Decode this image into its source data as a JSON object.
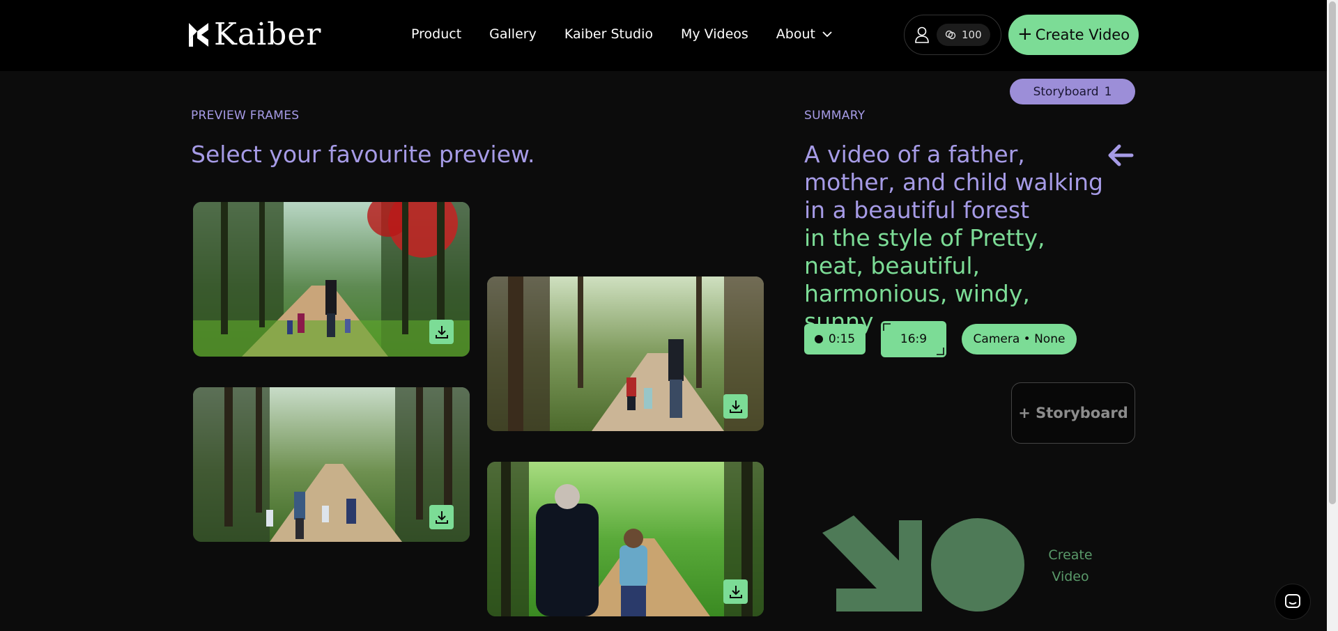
{
  "header": {
    "logo_text": "Kaiber",
    "nav": [
      {
        "label": "Product"
      },
      {
        "label": "Gallery"
      },
      {
        "label": "Kaiber Studio"
      },
      {
        "label": "My Videos"
      },
      {
        "label": "About"
      }
    ],
    "credits": "100",
    "create_label": "Create Video"
  },
  "storyboard_badge": {
    "label": "Storyboard",
    "count": "1"
  },
  "preview": {
    "section_label": "PREVIEW FRAMES",
    "headline": "Select your favourite preview."
  },
  "summary": {
    "section_label": "SUMMARY",
    "prompt": "A video of a father, mother, and child walking in a beautiful forest",
    "style": "in the style of Pretty, neat, beautiful, harmonious, windy, sunny",
    "duration": "0:15",
    "aspect_ratio": "16:9",
    "camera": "Camera • None",
    "add_storyboard": "+ Storyboard",
    "create_label_1": "Create",
    "create_label_2": "Video"
  },
  "colors": {
    "accent_green": "#7cdc96",
    "accent_purple": "#a69be6",
    "badge_purple": "#9c8ed8",
    "background": "#0c0c0c",
    "header": "#000000",
    "dark_green": "#4e7a57"
  }
}
